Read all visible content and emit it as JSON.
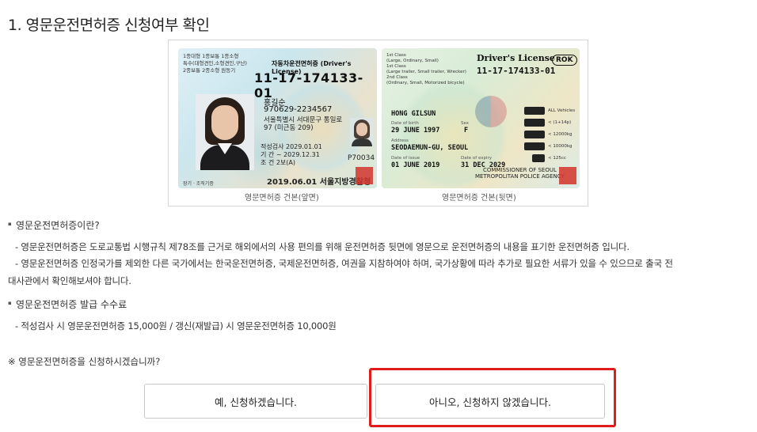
{
  "section": {
    "title": "1. 영문운전면허증 신청여부 확인"
  },
  "license_image": {
    "front": {
      "class_lines": [
        "1종대형 1종보통 1종소형",
        "특수(대형견인,소형견인,구난)",
        "2종보통 2종소형 원동기"
      ],
      "heading": "자동차운전면허증 (Driver's License)",
      "number": "11-17-174133-01",
      "name": "홍길순",
      "id_number": "970629-2234567",
      "address_1": "서울특별시 서대문구 통일로",
      "address_2": "97 (미근동 209)",
      "aptitude_label": "적성검사",
      "aptitude_date": "2029.01.01",
      "period_label": "기    간",
      "period_value": "~ 2029.12.31",
      "condition_label": "조    건",
      "condition_value": "2보(A)",
      "code": "P70034",
      "issue": "2019.06.01 서울지방경찰청장",
      "bottom_note": "장기 · 조직기증",
      "caption": "영문면허증 건본(앞면)"
    },
    "back": {
      "class_lines": [
        "1st Class",
        "(Large, Ordinary, Small)",
        "1st Class",
        "(Large trailer, Small trailer, Wrecker)",
        "2nd Class",
        "(Ordinary, Small, Motorized bicycle)"
      ],
      "title": "Driver's License",
      "country": "ROK",
      "number": "11-17-174133-01",
      "name": "HONG GILSUN",
      "dob_label": "Date of birth",
      "dob": "29 JUNE 1997",
      "sex_label": "Sex",
      "sex": "F",
      "address_label": "Address",
      "address": "SEODAEMUN-GU, SEOUL",
      "issue_label": "Date of issue",
      "issue": "01 JUNE 2019",
      "expiry_label": "Date of expiry",
      "expiry": "31 DEC 2029",
      "vehicle_labels": [
        "ALL Vehicles",
        "< (1+14p)",
        "< 12000kg",
        "< 10000kg",
        "< 125cc"
      ],
      "commissioner_1": "COMMISSIONER OF SEOUL",
      "commissioner_2": "METROPOLITAN POLICE AGENCY",
      "caption": "영문면허증 건본(뒷면)"
    }
  },
  "info": {
    "what_title": "영문운전면허증이란?",
    "what_desc_1": "- 영문운전면허증은 도로교통법 시행규칙 제78조를 근거로 해외에서의 사용 편의를 위해 운전면허증 뒷면에 영문으로 운전면허증의 내용을 표기한 운전면허증 입니다.",
    "what_desc_2": "- 영문운전면허증 인정국가를 제외한 다른 국가에서는 한국운전면허증, 국제운전면허증, 여권을 지참하여야 하며, 국가상황에 따라 추가로 필요한 서류가 있을 수 있으므로 출국 전",
    "what_desc_3": "대사관에서 확인해보셔야 합니다.",
    "fee_title": "영문운전면허증 발급 수수료",
    "fee_desc": "- 적성검사 시 영문운전면허증 15,000원 / 갱신(재발급) 시 영문운전면허증 10,000원"
  },
  "question": "※ 영문운전면허증을 신청하시겠습니까?",
  "buttons": {
    "yes": "예, 신청하겠습니다.",
    "no": "아니오, 신청하지 않겠습니다."
  },
  "colors": {
    "highlight": "#e01b1b",
    "button_border": "#c8c8c8"
  }
}
